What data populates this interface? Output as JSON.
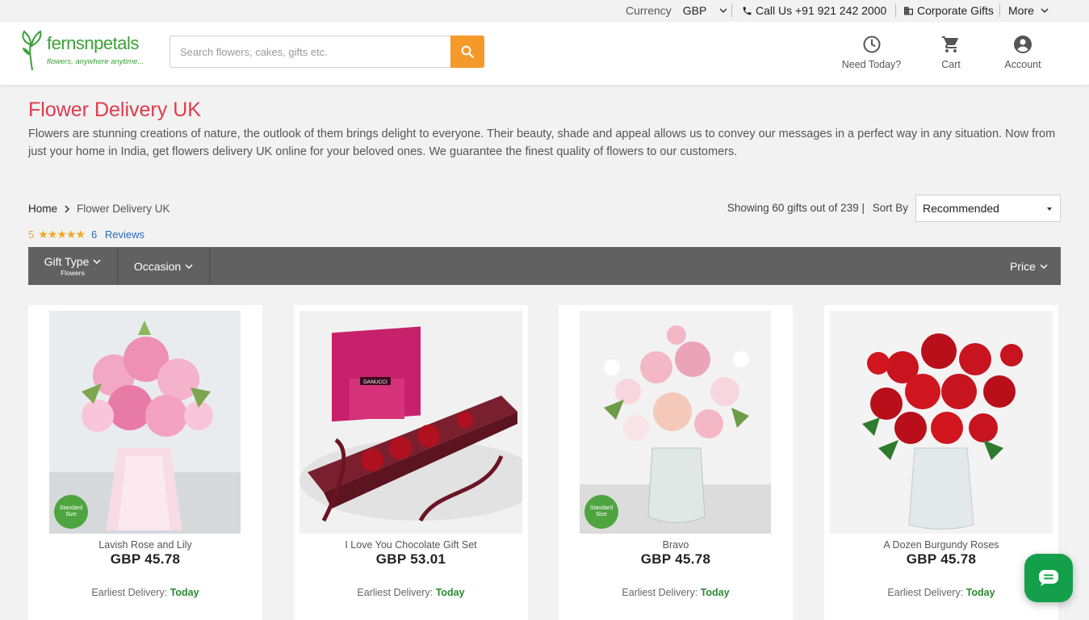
{
  "topbar": {
    "currency_label": "Currency",
    "currency_value": "GBP",
    "call_label": "Call Us +91 921 242 2000",
    "corporate_label": "Corporate Gifts",
    "more_label": "More"
  },
  "header": {
    "logo_text": "fernsnpetals",
    "logo_tagline": "flowers, anywhere anytime...",
    "search_placeholder": "Search flowers, cakes, gifts etc.",
    "actions": [
      {
        "label": "Need Today?",
        "icon": "clock-icon"
      },
      {
        "label": "Cart",
        "icon": "cart-icon"
      },
      {
        "label": "Account",
        "icon": "account-icon"
      }
    ]
  },
  "page": {
    "title": "Flower Delivery UK",
    "description": "Flowers are stunning creations of nature, the outlook of them brings delight to everyone. Their beauty, shade and appeal allows us to convey our messages in a perfect way in any situation. Now from just your home in India, get flowers delivery UK online for your beloved ones. We guarantee the finest quality of flowers to our customers."
  },
  "breadcrumb": {
    "home": "Home",
    "current": "Flower Delivery UK"
  },
  "rating": {
    "score": "5",
    "stars": "★★★★★",
    "reviews_count": "6",
    "reviews_label": "Reviews"
  },
  "listing": {
    "showing_text": "Showing 60 gifts out of 239 |",
    "sort_label": "Sort By",
    "sort_value": "Recommended"
  },
  "filters": {
    "gift_type": {
      "label": "Gift Type",
      "value": "Flowers"
    },
    "occasion": {
      "label": "Occasion"
    },
    "price": {
      "label": "Price"
    }
  },
  "products": [
    {
      "name": "Lavish Rose and Lily",
      "price": "GBP  45.78",
      "delivery_label": "Earliest Delivery:",
      "delivery_value": "Today",
      "badge": "Standard Size"
    },
    {
      "name": "I Love You Chocolate Gift Set",
      "price": "GBP  53.01",
      "delivery_label": "Earliest Delivery:",
      "delivery_value": "Today",
      "box_text": "DANUCCI"
    },
    {
      "name": "Bravo",
      "price": "GBP  45.78",
      "delivery_label": "Earliest Delivery:",
      "delivery_value": "Today",
      "badge": "Standard Size"
    },
    {
      "name": "A Dozen Burgundy Roses",
      "price": "GBP  45.78",
      "delivery_label": "Earliest Delivery:",
      "delivery_value": "Today"
    }
  ],
  "colors": {
    "brand_green": "#3aa136",
    "title_red": "#e03b4c",
    "search_orange": "#f59a2a",
    "filterbar": "#616161",
    "delivery_green": "#2a8a2f",
    "chat_green": "#14a04b"
  }
}
